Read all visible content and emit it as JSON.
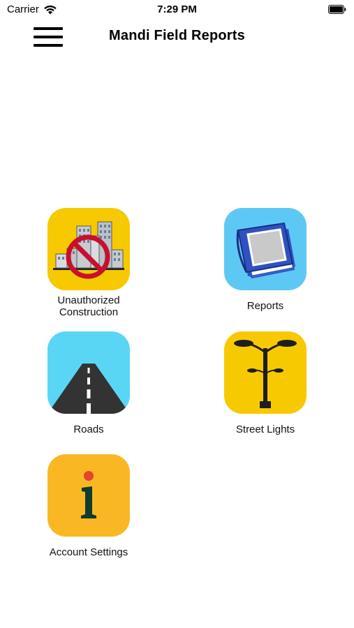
{
  "status_bar": {
    "carrier": "Carrier",
    "time": "7:29 PM"
  },
  "nav": {
    "title": "Mandi Field Reports"
  },
  "tiles": [
    {
      "label": "Unauthorized\nConstruction",
      "icon": "no-construction-icon",
      "bg": "#f7c900"
    },
    {
      "label": "Reports",
      "icon": "report-book-icon",
      "bg": "#5ec8f5"
    },
    {
      "label": "Roads",
      "icon": "road-icon",
      "bg": "#5ad6f5"
    },
    {
      "label": "Street Lights",
      "icon": "street-light-icon",
      "bg": "#f7c900"
    },
    {
      "label": "Account Settings",
      "icon": "info-icon",
      "bg": "#f9b823"
    }
  ]
}
